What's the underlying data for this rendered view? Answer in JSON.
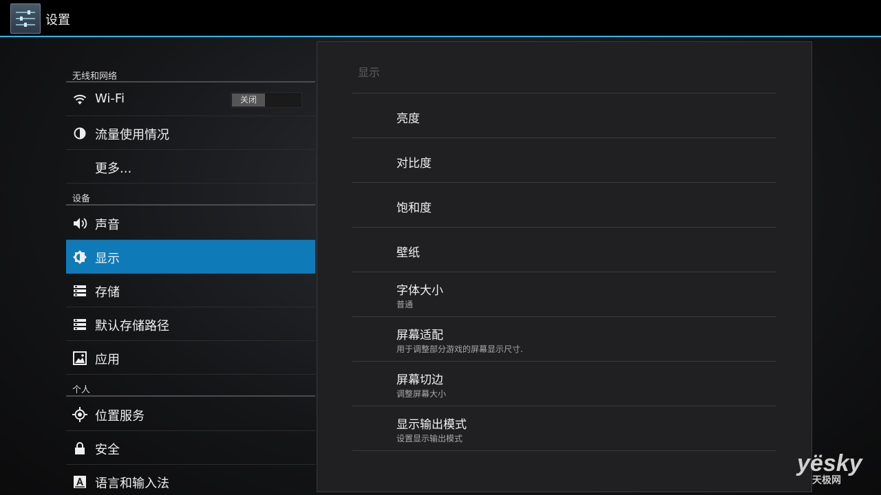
{
  "actionbar": {
    "title": "设置",
    "icon": "settings-sliders-icon"
  },
  "sections": [
    {
      "header": "无线和网络"
    },
    {
      "header": "设备"
    },
    {
      "header": "个人"
    }
  ],
  "nav": {
    "wifi": {
      "label": "Wi-Fi",
      "icon": "wifi-icon",
      "toggle_label": "关闭"
    },
    "data_usage": {
      "label": "流量使用情况",
      "icon": "pie-chart-icon"
    },
    "more": {
      "label": "更多..."
    },
    "sound": {
      "label": "声音",
      "icon": "speaker-icon"
    },
    "display": {
      "label": "显示",
      "icon": "brightness-icon",
      "selected": true
    },
    "storage": {
      "label": "存储",
      "icon": "storage-icon"
    },
    "default_storage_path": {
      "label": "默认存储路径",
      "icon": "storage-icon"
    },
    "apps": {
      "label": "应用",
      "icon": "apps-icon"
    },
    "location": {
      "label": "位置服务",
      "icon": "location-icon"
    },
    "security": {
      "label": "安全",
      "icon": "lock-icon"
    },
    "language_input": {
      "label": "语言和输入法",
      "icon": "keyboard-a-icon"
    }
  },
  "detail": {
    "header": "显示",
    "items": [
      {
        "title": "亮度",
        "summary": ""
      },
      {
        "title": "对比度",
        "summary": ""
      },
      {
        "title": "饱和度",
        "summary": ""
      },
      {
        "title": "壁纸",
        "summary": ""
      },
      {
        "title": "字体大小",
        "summary": "普通"
      },
      {
        "title": "屏幕适配",
        "summary": "用于调整部分游戏的屏幕显示尺寸."
      },
      {
        "title": "屏幕切边",
        "summary": "调整屏幕大小"
      },
      {
        "title": "显示输出模式",
        "summary": "设置显示输出模式"
      }
    ]
  },
  "watermark": {
    "brand": "yesky",
    "brand_display": "yësky",
    "sub": "天极网"
  },
  "colors": {
    "accent": "#33b5e5",
    "selected": "#0e7ab8"
  }
}
